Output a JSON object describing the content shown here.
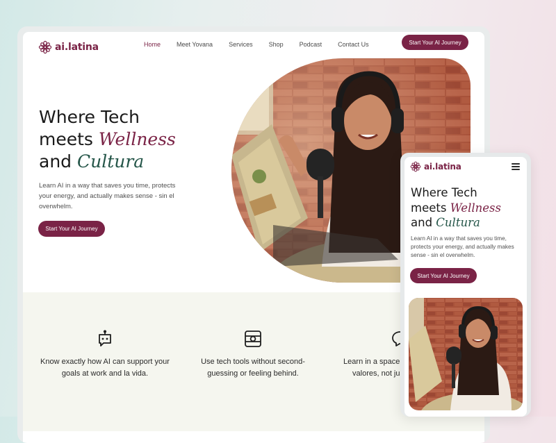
{
  "brand": {
    "name": "ai.latina",
    "color": "#7a2346",
    "accent_green": "#245548"
  },
  "nav": {
    "items": [
      {
        "label": "Home",
        "active": true
      },
      {
        "label": "Meet Yovana",
        "active": false
      },
      {
        "label": "Services",
        "active": false
      },
      {
        "label": "Shop",
        "active": false
      },
      {
        "label": "Podcast",
        "active": false
      },
      {
        "label": "Contact Us",
        "active": false
      }
    ],
    "cta_label": "Start Your AI Journey"
  },
  "hero": {
    "line1": "Where Tech",
    "line2_prefix": "meets ",
    "line2_emphasis": "Wellness",
    "line3_prefix": "and ",
    "line3_emphasis": "Cultura",
    "subtitle": "Learn AI in a way that saves you time, protects your energy, and actually makes sense - sin el overwhelm.",
    "cta_label": "Start Your AI Journey"
  },
  "features": [
    {
      "icon": "robot-icon",
      "text": "Know exactly how AI can support your goals at work and la vida."
    },
    {
      "icon": "tools-icon",
      "text": "Use tech tools without second-guessing or feeling behind."
    },
    {
      "icon": "chat-icon",
      "text": "Learn in a space that honors your valores, not just productivity."
    }
  ],
  "mobile": {
    "menu_icon": "hamburger-icon"
  }
}
